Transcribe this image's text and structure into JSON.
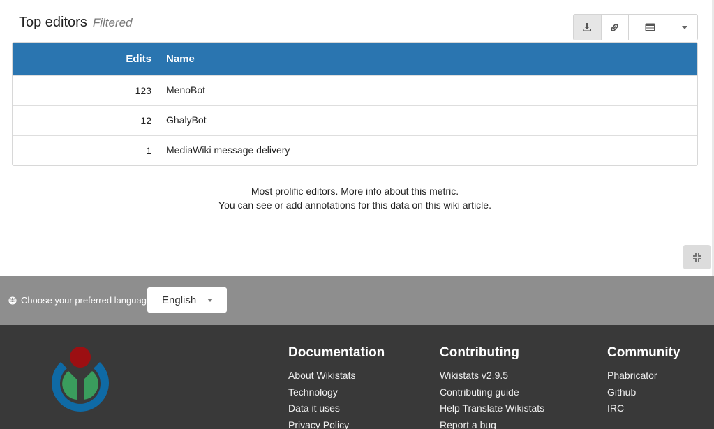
{
  "widget": {
    "title": "Top editors",
    "filter_label": "Filtered"
  },
  "toolbar": {
    "icons": [
      "download-icon",
      "link-icon",
      "table-icon",
      "chevron-down-icon"
    ]
  },
  "table": {
    "columns": [
      "Edits",
      "Name"
    ],
    "rows": [
      {
        "edits": "123",
        "name": "MenoBot"
      },
      {
        "edits": "12",
        "name": "GhalyBot"
      },
      {
        "edits": "1",
        "name": "MediaWiki message delivery"
      }
    ]
  },
  "info": {
    "line1_text": "Most prolific editors.",
    "line1_link": "More info about this metric.",
    "line2_text": "You can",
    "line2_link": "see or add annotations for this data on this wiki article."
  },
  "language": {
    "label": "Choose your preferred language",
    "selected": "English"
  },
  "footer": {
    "documentation": {
      "heading": "Documentation",
      "items": [
        "About Wikistats",
        "Technology",
        "Data it uses",
        "Privacy Policy"
      ]
    },
    "contributing": {
      "heading": "Contributing",
      "items": [
        "Wikistats v2.9.5",
        "Contributing guide",
        "Help Translate Wikistats",
        "Report a bug"
      ]
    },
    "community": {
      "heading": "Community",
      "items": [
        "Phabricator",
        "Github",
        "IRC"
      ]
    }
  },
  "colors": {
    "table_header": "#2a75b0",
    "footer_bg": "#393939",
    "language_bar_bg": "#8e8e8e"
  }
}
